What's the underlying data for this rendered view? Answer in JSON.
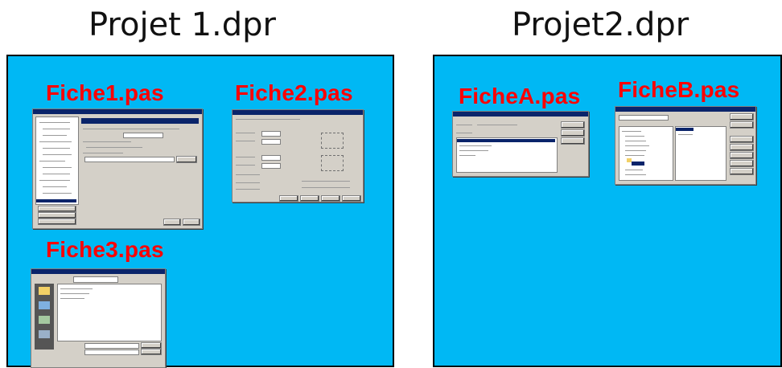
{
  "projects": [
    {
      "title": "Projet 1.dpr",
      "forms": [
        "Fiche1.pas",
        "Fiche2.pas",
        "Fiche3.pas"
      ]
    },
    {
      "title": "Projet2.dpr",
      "forms": [
        "FicheA.pas",
        "FicheB.pas"
      ]
    }
  ],
  "colors": {
    "panel_background": "#00b8f4",
    "form_label": "#ff0000",
    "window_face": "#d4d0c8",
    "title_bar": "#0a246a"
  }
}
